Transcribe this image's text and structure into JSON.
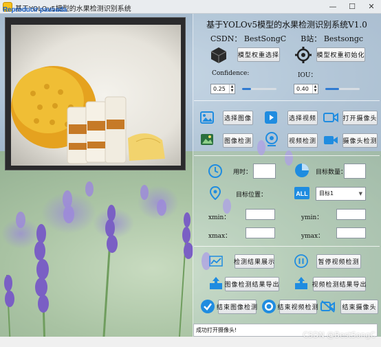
{
  "window": {
    "title": "基于YOLOv5模型的水果检测识别系统",
    "logo_text": "Reproducir pausada"
  },
  "header": {
    "title": "基于YOLOv5模型的水果检测识别系统V1.0",
    "csdn_label": "CSDN：",
    "csdn_value": "BestSongC",
    "bilibili_label": "B站：",
    "bilibili_value": "Bestsongc"
  },
  "model": {
    "select_weights_label": "模型权重选择",
    "init_weights_label": "模型权重初始化"
  },
  "params": {
    "confidence_label": "Confidence:",
    "confidence_value": "0.25",
    "confidence_fraction": 0.25,
    "iou_label": "IOU：",
    "iou_value": "0.40",
    "iou_fraction": 0.4
  },
  "media": {
    "select_image": "选择图像",
    "select_video": "选择视频",
    "open_camera": "打开摄像头",
    "image_detect": "图像检测",
    "video_detect": "视频检测",
    "camera_detect": "摄像头检测"
  },
  "results": {
    "time_label": "用时：",
    "target_count_label": "目标数量：",
    "target_pos_label": "目标位置：",
    "target_select_value": "目标1",
    "xmin_label": "xmin：",
    "ymin_label": "ymin：",
    "xmax_label": "xmax：",
    "ymax_label": "ymax："
  },
  "actions": {
    "show_results": "检测结果展示",
    "pause_video": "暂停视频检测",
    "export_image": "图像检测结果导出",
    "export_video": "视频检测结果导出",
    "end_image": "结束图像检测",
    "end_video": "结束视频检测",
    "end_camera": "结束摄像头"
  },
  "status": {
    "message": "成功打开摄像头!"
  },
  "watermark": "CSDN @BestSongC",
  "icons": {
    "cube": "cube-icon",
    "gear": "gear-icon",
    "image": "image-icon",
    "video": "video-play-icon",
    "camera": "camera-icon",
    "photo": "photo-icon",
    "webcam": "webcam-icon",
    "clock": "clock-icon",
    "pie": "pie-chart-icon",
    "location": "location-pin-icon",
    "all": "all-icon",
    "chart": "line-chart-icon",
    "pause": "pause-icon",
    "upload": "upload-icon",
    "check": "check-circle-icon",
    "stop": "stop-icon",
    "camera_off": "camera-off-icon"
  },
  "colors": {
    "accent": "#2f7ad1",
    "icon_blue": "#1f8ce0"
  }
}
